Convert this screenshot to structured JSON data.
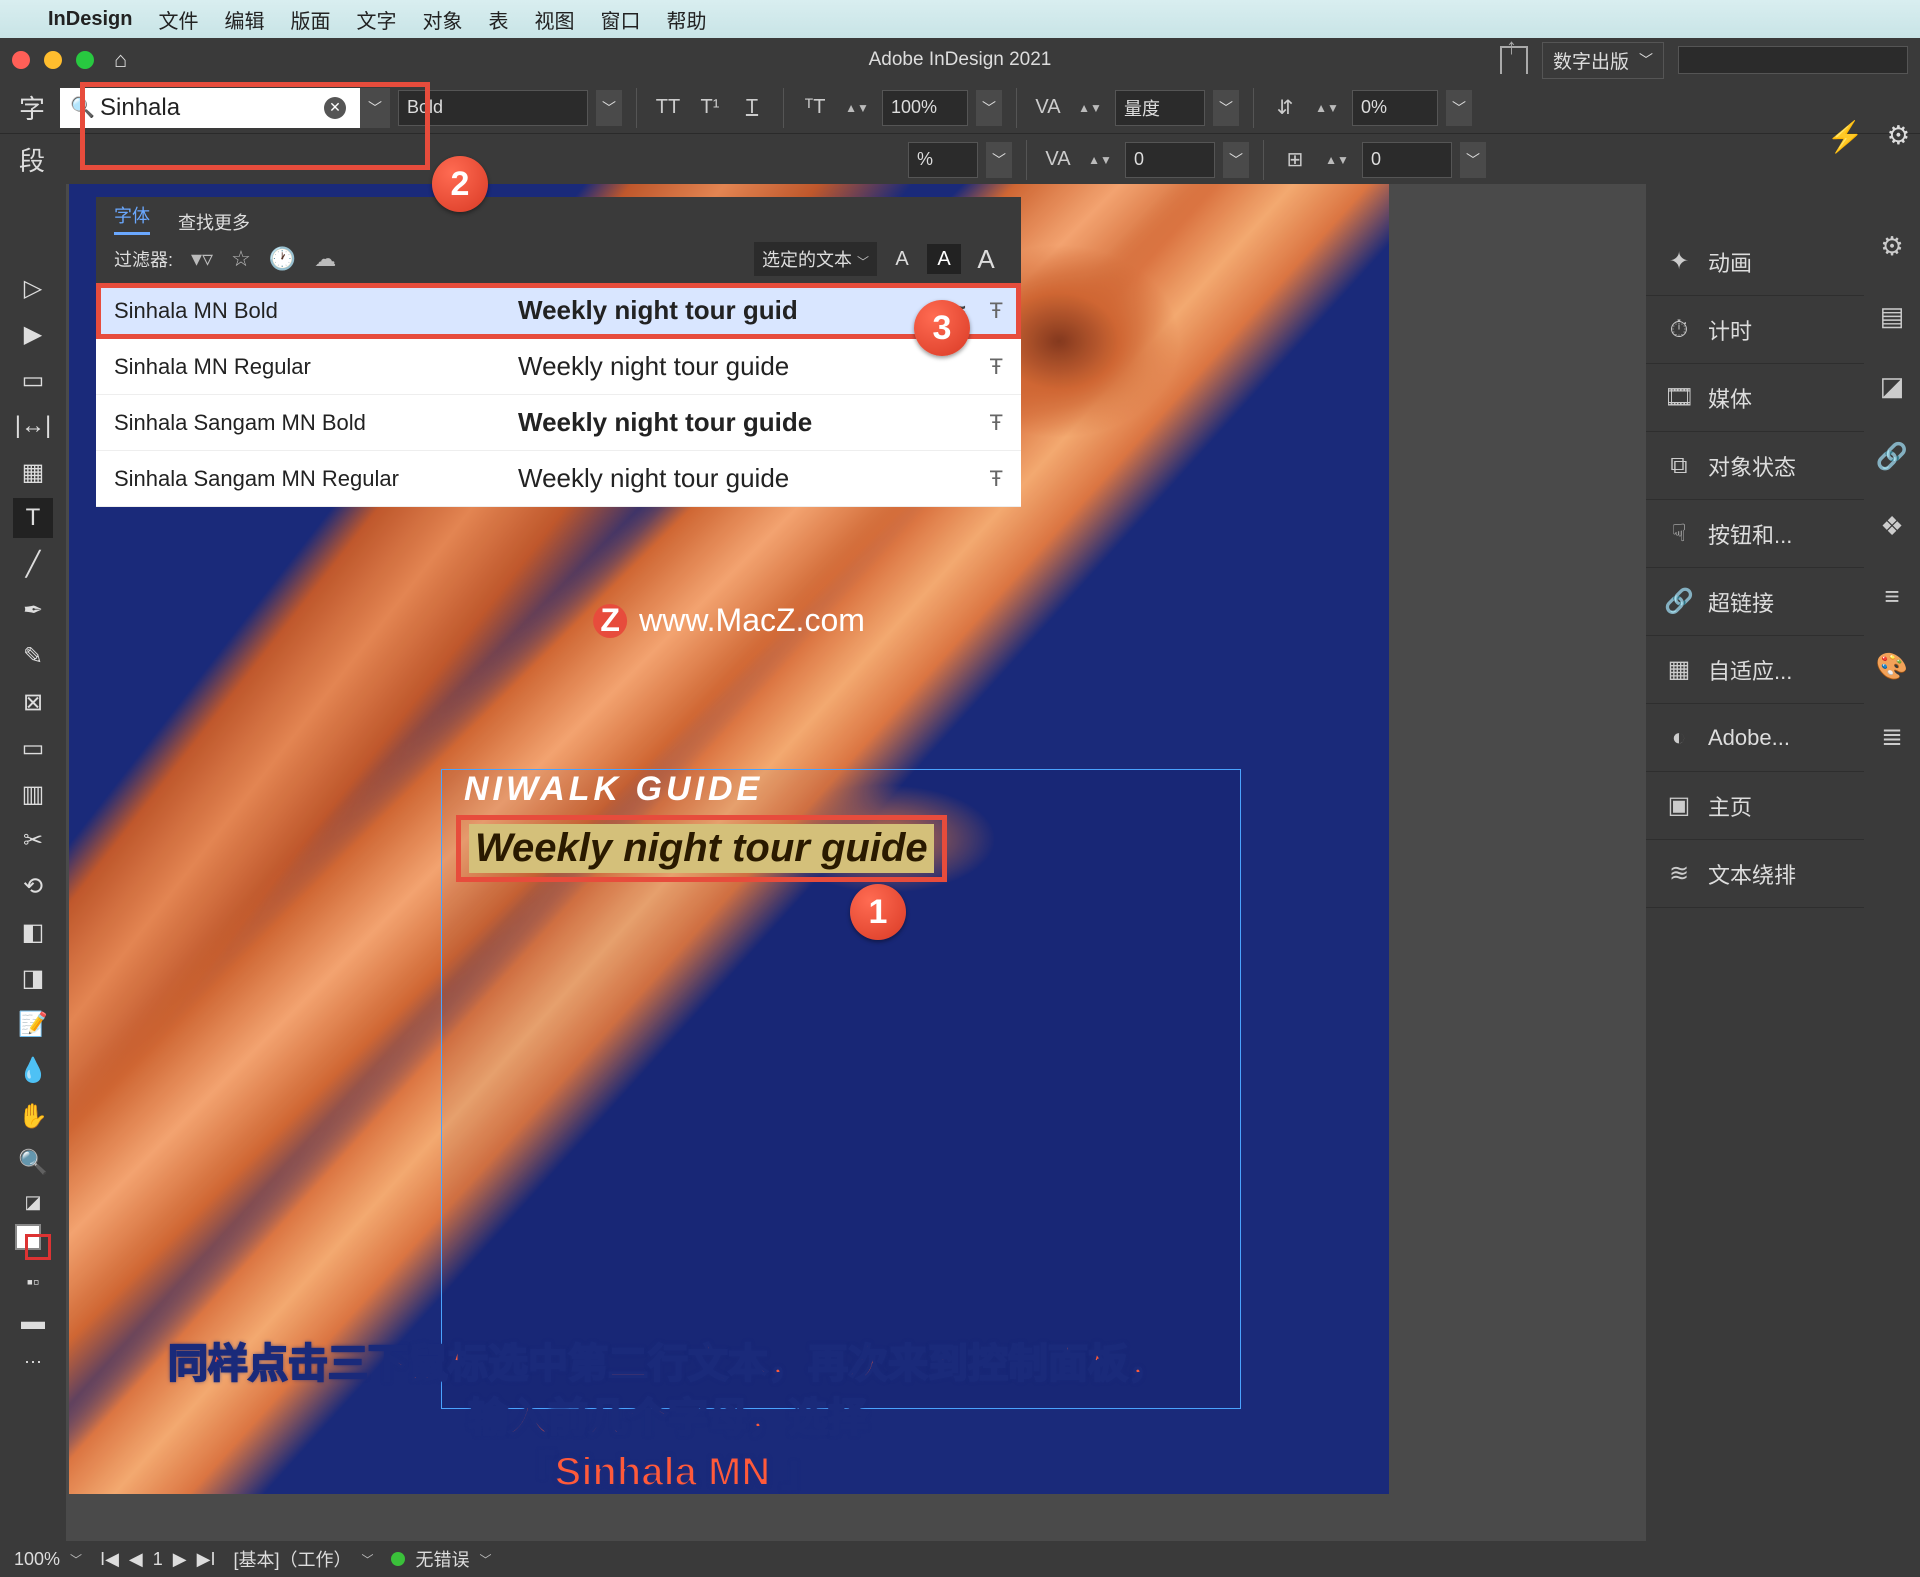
{
  "mac_menu": {
    "app": "InDesign",
    "items": [
      "文件",
      "编辑",
      "版面",
      "文字",
      "对象",
      "表",
      "视图",
      "窗口",
      "帮助"
    ]
  },
  "titlebar": {
    "title": "Adobe InDesign 2021",
    "publish_setting": "数字出版"
  },
  "control": {
    "char_tab": "字",
    "para_tab": "段",
    "font_search_value": "Sinhala ",
    "font_style": "Bold",
    "size_pct": "100%",
    "leading_label": "量度",
    "kern_value": "0",
    "baseline_pct": "0%",
    "track_value": "0",
    "scale_pct_2": "%"
  },
  "font_panel": {
    "tab_fonts": "字体",
    "tab_more": "查找更多",
    "filter_label": "过滤器:",
    "selected_text": "选定的文本",
    "results": [
      {
        "name": "Sinhala MN Bold",
        "preview": "Weekly night tour guid",
        "bold": true,
        "selected": true,
        "approx": true
      },
      {
        "name": "Sinhala MN Regular",
        "preview": "Weekly night tour guide",
        "bold": false,
        "selected": false,
        "approx": false
      },
      {
        "name": "Sinhala Sangam MN Bold",
        "preview": "Weekly night tour guide",
        "bold": true,
        "selected": false,
        "approx": false
      },
      {
        "name": "Sinhala Sangam MN Regular",
        "preview": "Weekly night tour guide",
        "bold": false,
        "selected": false,
        "approx": false
      }
    ]
  },
  "canvas": {
    "frame_title": "NIWALK  GUIDE",
    "frame_subtitle": "Weekly night tour guide",
    "watermark": "www.MacZ.com"
  },
  "right_panels": [
    {
      "icon": "✦",
      "label": "动画"
    },
    {
      "icon": "⏱",
      "label": "计时"
    },
    {
      "icon": "🎞",
      "label": "媒体"
    },
    {
      "icon": "⧉",
      "label": "对象状态"
    },
    {
      "icon": "☟",
      "label": "按钮和..."
    },
    {
      "icon": "🔗",
      "label": "超链接"
    },
    {
      "icon": "▦",
      "label": "自适应..."
    },
    {
      "icon": "◐",
      "label": "Adobe..."
    },
    {
      "icon": "▣",
      "label": "主页"
    },
    {
      "icon": "≋",
      "label": "文本绕排"
    }
  ],
  "statusbar": {
    "zoom": "100%",
    "page": "1",
    "doc": "[基本]（工作）",
    "errors": "无错误"
  },
  "instruction_line1": "同样点击三下鼠标选中第二行文本，再次来到控制面板，输入前几个字母，选择",
  "instruction_line2": "「Sinhala MN 」",
  "annotations": {
    "n1": "1",
    "n2": "2",
    "n3": "3"
  }
}
